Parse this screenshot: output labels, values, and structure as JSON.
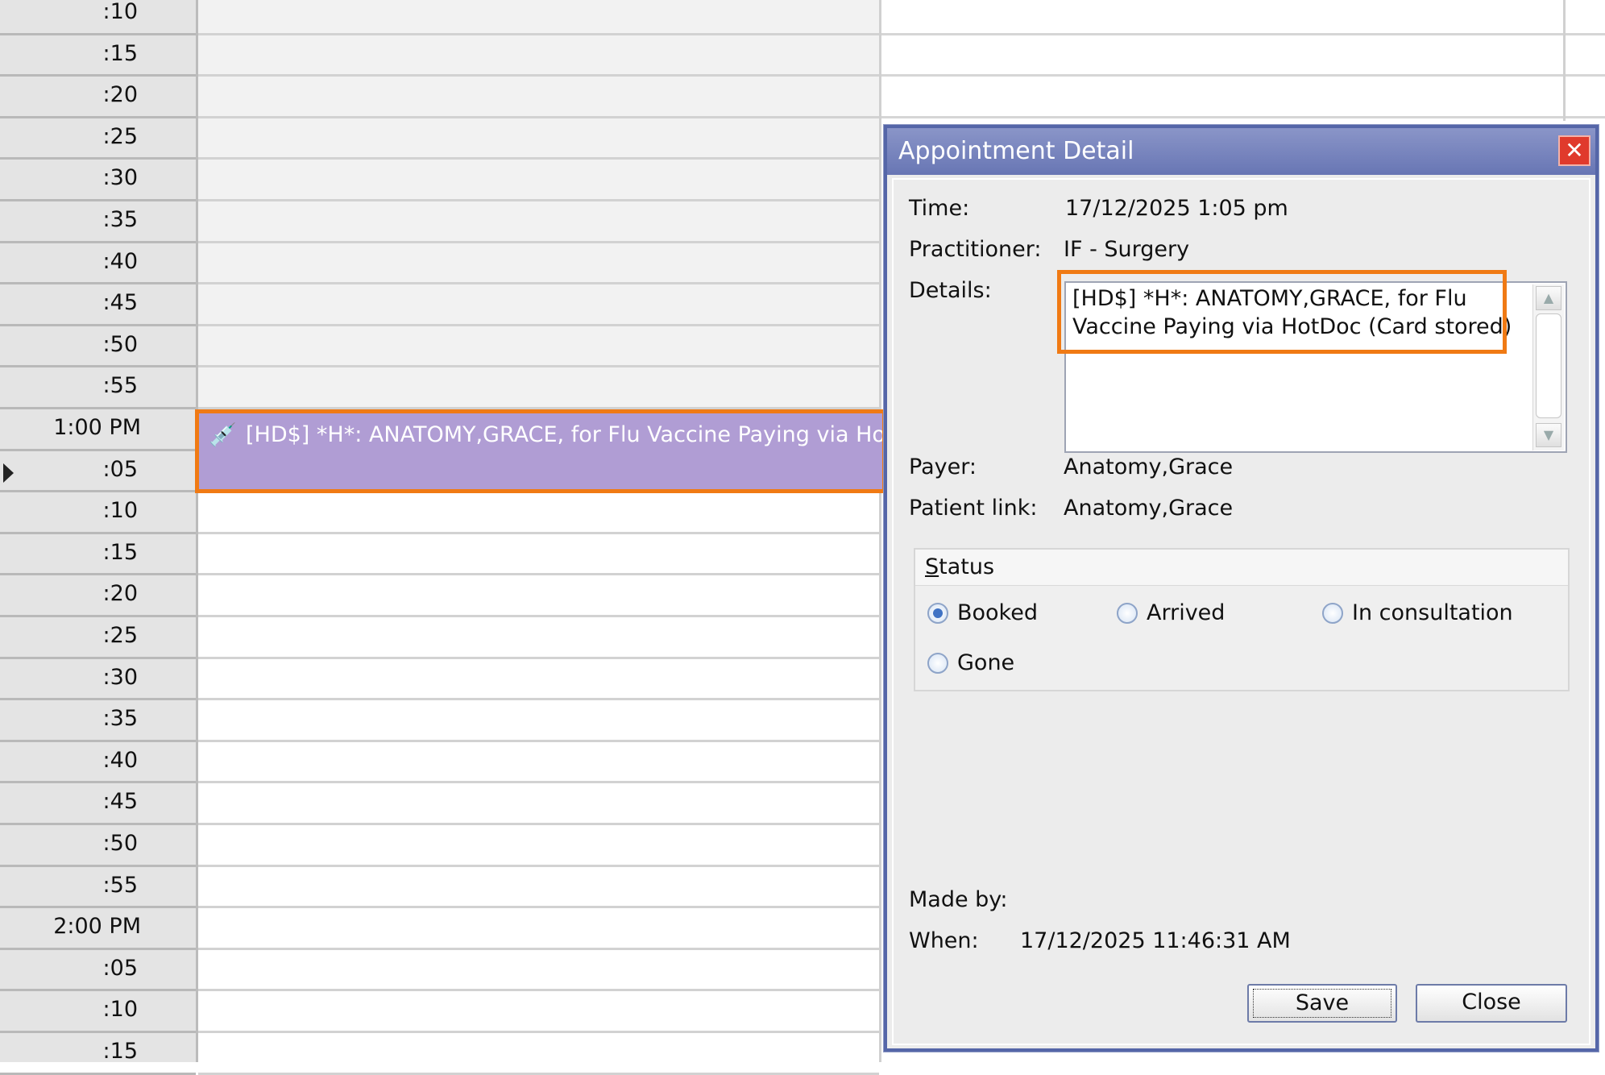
{
  "schedule": {
    "time_labels": [
      ":10",
      ":15",
      ":20",
      ":25",
      ":30",
      ":35",
      ":40",
      ":45",
      ":50",
      ":55",
      "1:00 PM",
      ":05",
      ":10",
      ":15",
      ":20",
      ":25",
      ":30",
      ":35",
      ":40",
      ":45",
      ":50",
      ":55",
      "2:00 PM",
      ":05",
      ":10",
      ":15"
    ],
    "appointment": {
      "text": "[HD$] *H*: ANATOMY,GRACE,  for Flu Vaccine Paying via HotDoc (Card stored)",
      "icon": "syringe-icon",
      "color": "#b09dd4"
    },
    "highlight_color": "#f07a14"
  },
  "dialog": {
    "title": "Appointment Detail",
    "close_icon": "close-icon",
    "time_label": "Time:",
    "time_value": "17/12/2025 1:05 pm",
    "practitioner_label": "Practitioner:",
    "practitioner_value": "IF - Surgery",
    "details_label": "Details:",
    "details_value": "[HD$] *H*: ANATOMY,GRACE,  for Flu Vaccine Paying via HotDoc (Card stored)",
    "payer_label": "Payer:",
    "payer_value": "Anatomy,Grace",
    "patient_link_label": "Patient link:",
    "patient_link_value": "Anatomy,Grace",
    "status": {
      "title_first": "S",
      "title_rest": "tatus",
      "options": [
        {
          "label": "Booked",
          "selected": true
        },
        {
          "label": "Arrived",
          "selected": false
        },
        {
          "label": "In consultation",
          "selected": false
        },
        {
          "label": "Gone",
          "selected": false
        }
      ]
    },
    "made_by_label": "Made by:",
    "when_label": "When:",
    "when_value": "17/12/2025 11:46:31 AM",
    "save_label": "Save",
    "close_label": "Close"
  }
}
